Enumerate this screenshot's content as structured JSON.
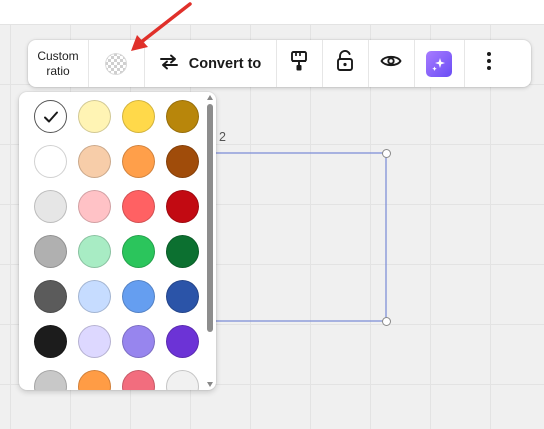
{
  "toolbar": {
    "ratio_line1": "Custom",
    "ratio_line2": "ratio",
    "convert_label": "Convert to"
  },
  "canvas": {
    "frame_label": "2"
  },
  "palette": {
    "swatches": [
      {
        "color": "#ffffff",
        "selected": true
      },
      {
        "color": "#fff4b4"
      },
      {
        "color": "#ffd94a"
      },
      {
        "color": "#b8860b"
      },
      {
        "color": "#ffffff"
      },
      {
        "color": "#f7cda9"
      },
      {
        "color": "#ff9f4a"
      },
      {
        "color": "#a04c0a"
      },
      {
        "color": "#e6e6e6"
      },
      {
        "color": "#ffc2c6"
      },
      {
        "color": "#ff6163"
      },
      {
        "color": "#c20a12"
      },
      {
        "color": "#b0b0b0"
      },
      {
        "color": "#a8ecc4"
      },
      {
        "color": "#2bc55c"
      },
      {
        "color": "#0c7030"
      },
      {
        "color": "#5b5b5b"
      },
      {
        "color": "#c6dcff"
      },
      {
        "color": "#659ef0"
      },
      {
        "color": "#2b54a8"
      },
      {
        "color": "#1c1c1c"
      },
      {
        "color": "#ddd8ff"
      },
      {
        "color": "#9785ee"
      },
      {
        "color": "#6c33d6"
      },
      {
        "color": "#c8c8c8"
      },
      {
        "color": "#ff9c45"
      },
      {
        "color": "#f26d7e"
      },
      {
        "color": "#f1f1f1"
      }
    ]
  },
  "icons": {
    "convert": "arrows-swap-icon",
    "format": "paint-brush-icon",
    "lock": "unlock-icon",
    "view": "eye-icon",
    "ai": "sparkles-icon",
    "more": "more-vertical-icon"
  },
  "colors": {
    "accent_arrow": "#e0302a",
    "frame_stroke": "#8090d8"
  }
}
